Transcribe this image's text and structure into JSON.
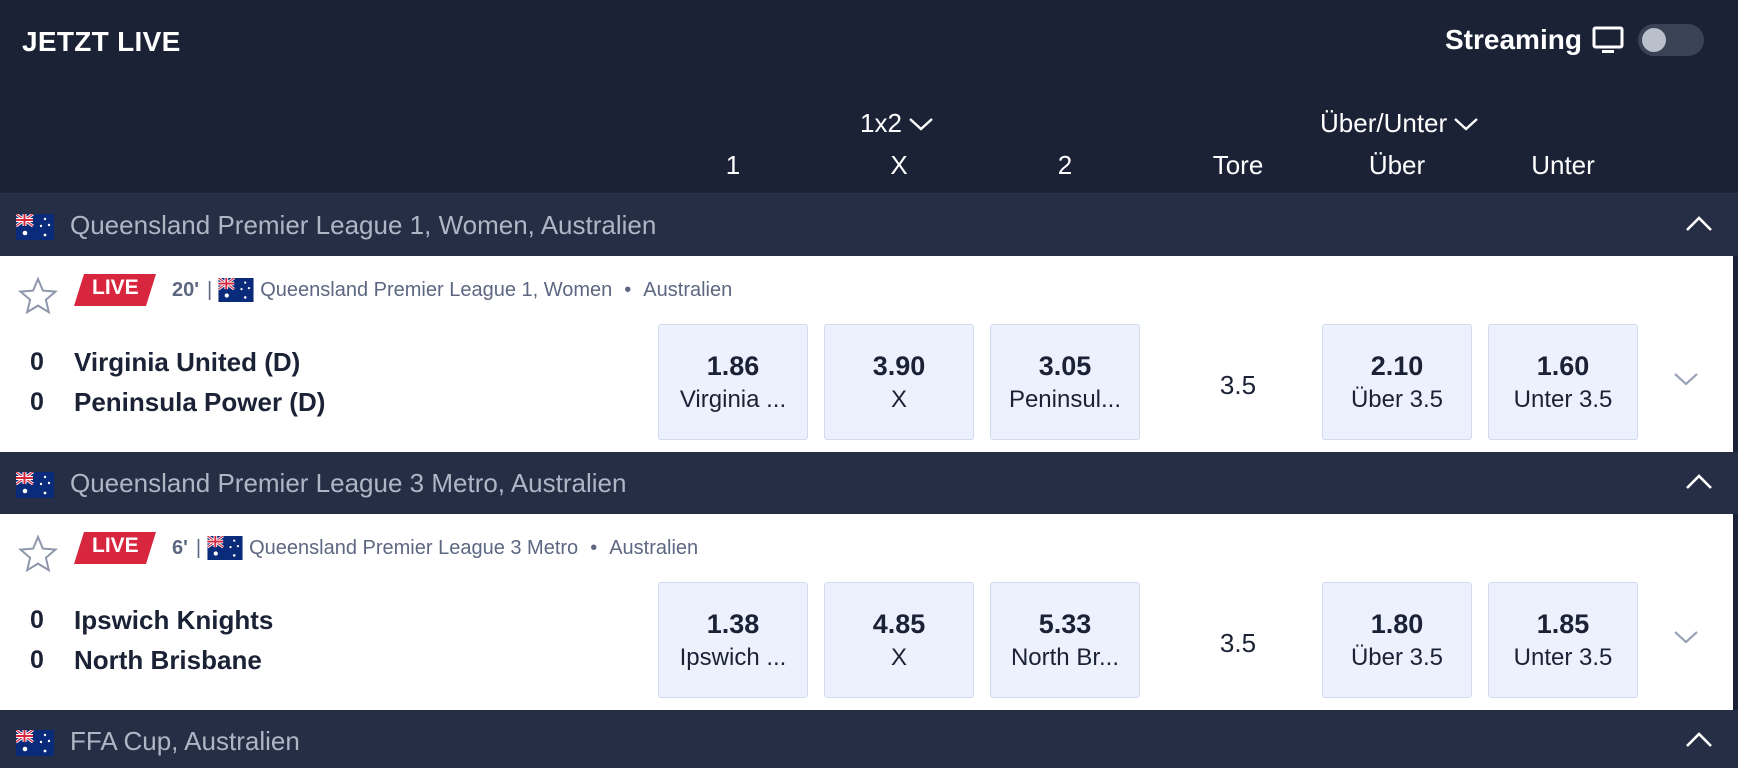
{
  "header": {
    "title": "JETZT LIVE",
    "streaming_label": "Streaming",
    "streaming_icon": "monitor-icon",
    "streaming_enabled": false
  },
  "columns": {
    "group1_label": "1x2",
    "group2_label": "Über/Unter",
    "col1": "1",
    "colx": "X",
    "col2": "2",
    "tore": "Tore",
    "over": "Über",
    "under": "Unter"
  },
  "leagues": [
    {
      "name": "Queensland Premier League 1, Women, Australien",
      "match": {
        "live_label": "LIVE",
        "minute": "20'",
        "separator": "|",
        "competition": "Queensland Premier League 1, Women",
        "dot": "•",
        "country": "Australien",
        "home_score": "0",
        "away_score": "0",
        "home_team": "Virginia United (D)",
        "away_team": "Peninsula Power (D)",
        "odds": [
          {
            "value": "1.86",
            "label": "Virginia ..."
          },
          {
            "value": "3.90",
            "label": "X"
          },
          {
            "value": "3.05",
            "label": "Peninsul..."
          }
        ],
        "tore": "3.5",
        "ou": [
          {
            "value": "2.10",
            "label": "Über 3.5"
          },
          {
            "value": "1.60",
            "label": "Unter 3.5"
          }
        ]
      }
    },
    {
      "name": "Queensland Premier League 3 Metro, Australien",
      "match": {
        "live_label": "LIVE",
        "minute": "6'",
        "separator": "|",
        "competition": "Queensland Premier League 3 Metro",
        "dot": "•",
        "country": "Australien",
        "home_score": "0",
        "away_score": "0",
        "home_team": "Ipswich Knights",
        "away_team": "North Brisbane",
        "odds": [
          {
            "value": "1.38",
            "label": "Ipswich ..."
          },
          {
            "value": "4.85",
            "label": "X"
          },
          {
            "value": "5.33",
            "label": "North Br..."
          }
        ],
        "tore": "3.5",
        "ou": [
          {
            "value": "1.80",
            "label": "Über 3.5"
          },
          {
            "value": "1.85",
            "label": "Unter 3.5"
          }
        ]
      }
    },
    {
      "name": "FFA Cup, Australien"
    }
  ],
  "colors": {
    "background": "#1b2236",
    "league_bar": "#252e45",
    "live_red": "#d7263d",
    "odd_bg": "#ecf1fd"
  }
}
